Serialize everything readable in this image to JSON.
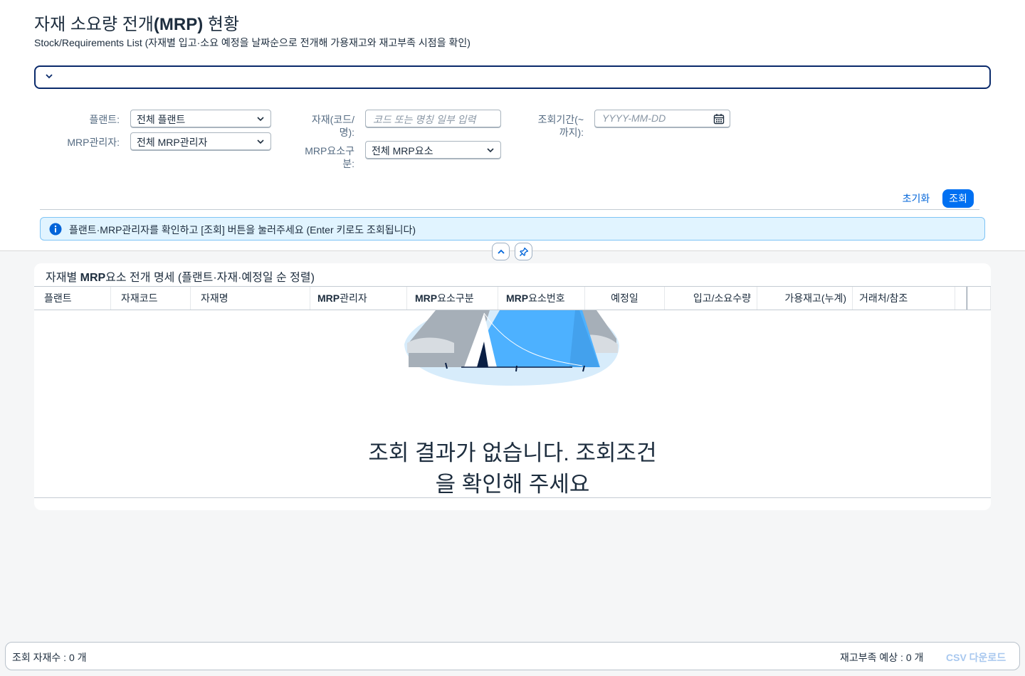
{
  "page": {
    "title_prefix": "자재 소요량 전개",
    "title_bold": "(MRP)",
    "title_suffix": " 현황",
    "subtitle": "Stock/Requirements List (자재별 입고·소요 예정을 날짜순으로 전개해 가용재고와 재고부족 시점을 확인)"
  },
  "filters": {
    "plant_label": "플랜트:",
    "plant_value": "전체 플랜트",
    "mrp_controller_label": "MRP관리자:",
    "mrp_controller_value": "전체 MRP관리자",
    "material_label_1": "자재(코드/",
    "material_label_2": "명):",
    "material_placeholder": "코드 또는 명칭 일부 입력",
    "mrp_element_label_1": "MRP요소구",
    "mrp_element_label_2": "분:",
    "mrp_element_value": "전체 MRP요소",
    "period_label_1": "조회기간(~",
    "period_label_2": "까지):",
    "period_placeholder": "YYYY-MM-DD"
  },
  "actions": {
    "reset_label": "초기화",
    "search_label": "조회"
  },
  "info": {
    "message": "플랜트·MRP관리자를 확인하고 [조회] 버튼을 눌러주세요 (Enter 키로도 조회됩니다)"
  },
  "table": {
    "title_prefix": "자재별 ",
    "title_bold": "MRP",
    "title_suffix": "요소 전개 명세 (플랜트·자재·예정일 순 정렬)",
    "columns": [
      {
        "bold": "",
        "text": "플랜트"
      },
      {
        "bold": "",
        "text": "자재코드"
      },
      {
        "bold": "",
        "text": "자재명"
      },
      {
        "bold": "MRP",
        "text": "관리자"
      },
      {
        "bold": "MRP",
        "text": "요소구분"
      },
      {
        "bold": "MRP",
        "text": "요소번호"
      },
      {
        "bold": "",
        "text": "예정일"
      },
      {
        "bold": "",
        "text": "입고/소요수량"
      },
      {
        "bold": "",
        "text": "가용재고(누계)"
      },
      {
        "bold": "",
        "text": "거래처/참조"
      }
    ],
    "empty_line_1": "조회 결과가 없습니다. 조회조건",
    "empty_line_2": "을 확인해 주세요"
  },
  "footer": {
    "count_text": "조회 자재수 : 0 개",
    "shortage_text": "재고부족 예상 : 0 개",
    "csv_label": "CSV 다운로드"
  },
  "colors": {
    "accent": "#0070f2",
    "link": "#0064d9",
    "info_bg": "#e1f4ff",
    "csv_disabled": "#a8c8ef"
  }
}
